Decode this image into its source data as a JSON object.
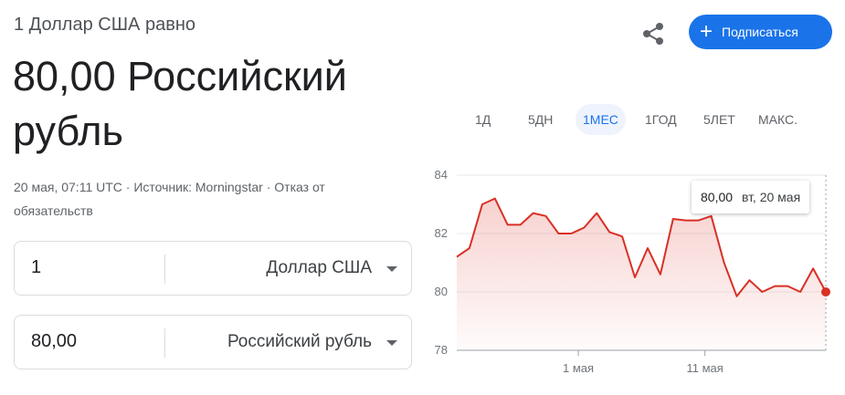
{
  "header": {
    "subtitle": "1 Доллар США равно",
    "value_line1": "80,00 Российский",
    "value_line2": "рубль",
    "meta_date": "20 мая, 07:11 UTC",
    "meta_source": "Источник: Morningstar",
    "meta_disclaimer": "Отказ от обязательств"
  },
  "actions": {
    "share_icon": "share-icon",
    "subscribe_label": "Подписаться",
    "subscribe_color": "#1a73e8"
  },
  "converter": {
    "from_amount": "1",
    "from_currency": "Доллар США",
    "to_amount": "80,00",
    "to_currency": "Российский рубль"
  },
  "ranges": {
    "tabs": [
      "1Д",
      "5ДН",
      "1МЕС",
      "1ГОД",
      "5ЛЕТ",
      "МАКС."
    ],
    "active": "1МЕС"
  },
  "tooltip": {
    "value": "80,00",
    "date": "вт, 20 мая"
  },
  "chart_data": {
    "type": "area",
    "ylim": [
      78,
      84
    ],
    "yticks": [
      "84",
      "82",
      "80",
      "78"
    ],
    "xticks": [
      "1 мая",
      "11 мая"
    ],
    "xtick_index": [
      9.55,
      19.5
    ],
    "line_color": "#d93025",
    "values": [
      81.2,
      81.5,
      83.0,
      83.2,
      82.3,
      82.3,
      82.7,
      82.6,
      82.0,
      82.0,
      82.2,
      82.7,
      82.05,
      81.9,
      80.5,
      81.5,
      80.6,
      82.5,
      82.45,
      82.45,
      82.6,
      81.0,
      79.85,
      80.4,
      80.0,
      80.2,
      80.2,
      80.0,
      80.8,
      80.0
    ],
    "grid": true,
    "legend": "none"
  }
}
